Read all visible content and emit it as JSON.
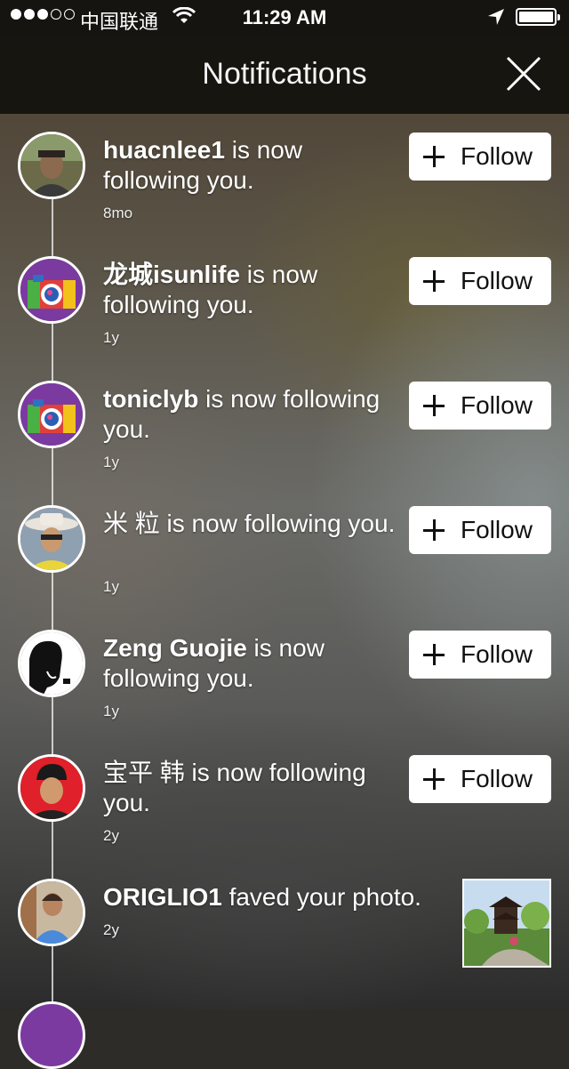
{
  "status_bar": {
    "carrier": "中国联通",
    "time": "11:29 AM",
    "signal_bars_filled": 3,
    "signal_bars_total": 5
  },
  "navbar": {
    "title": "Notifications",
    "close_icon": "close-icon"
  },
  "follow_label": "Follow",
  "notifications": [
    {
      "user": "huacnlee1",
      "action": " is now following you.",
      "time": "8mo",
      "type": "follow",
      "avatar": "photo-man"
    },
    {
      "user": "龙城isunlife",
      "action": " is now following you.",
      "time": "1y",
      "type": "follow",
      "avatar": "camera-default"
    },
    {
      "user": "toniclyb",
      "action": " is now following you.",
      "time": "1y",
      "type": "follow",
      "avatar": "camera-default"
    },
    {
      "user": "米 粒",
      "action": " is now following you.",
      "time": "1y",
      "type": "follow",
      "avatar": "photo-hat"
    },
    {
      "user": "Zeng Guojie",
      "action": " is now following you.",
      "time": "1y",
      "type": "follow",
      "avatar": "photo-silhouette"
    },
    {
      "user": "宝平 韩",
      "action": " is now following you.",
      "time": "2y",
      "type": "follow",
      "avatar": "photo-red"
    },
    {
      "user": "ORIGLIO1",
      "action": " faved your photo.",
      "time": "2y",
      "type": "fave",
      "avatar": "photo-woman",
      "photo": "garden-pagoda-photo"
    }
  ],
  "colors": {
    "bar_background": "#171510",
    "button_background": "#ffffff",
    "camera_avatar_purple": "#7b3aa0"
  }
}
